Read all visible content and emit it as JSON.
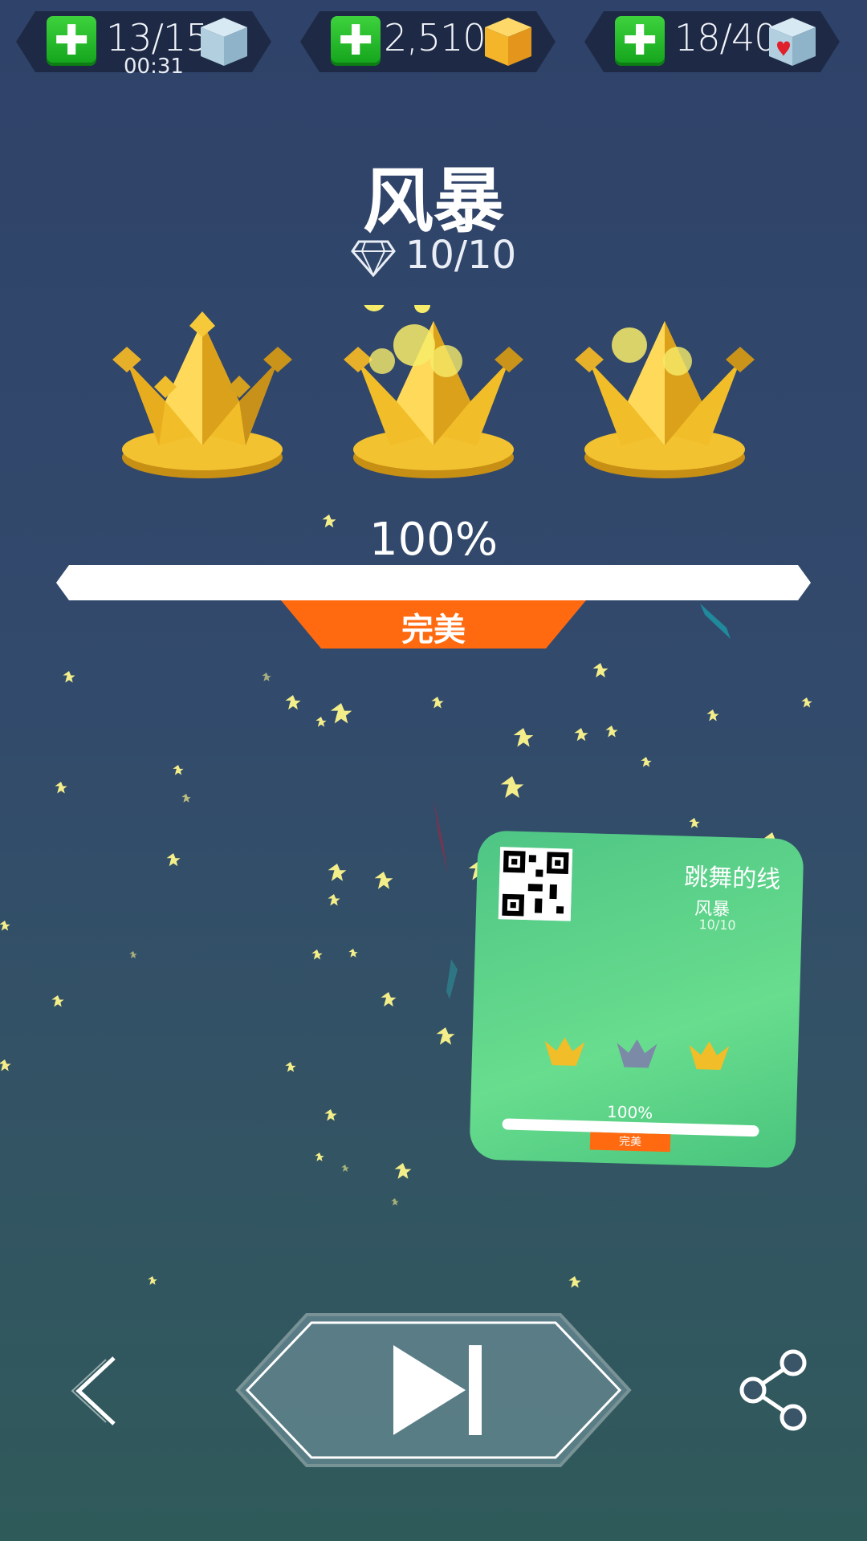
{
  "hud": {
    "energy": {
      "value": "13/15",
      "timer": "00:31",
      "icon": "ice-cube-icon"
    },
    "coins": {
      "value": "2,510",
      "icon": "gold-cube-icon"
    },
    "hearts": {
      "value": "18/40",
      "icon": "heart-cube-icon"
    }
  },
  "level": {
    "title": "风暴",
    "gems": "10/10",
    "crowns_earned": 3,
    "crowns_total": 3,
    "progress_label": "100%",
    "progress": 1.0,
    "rating": "完美"
  },
  "share_card": {
    "app_name": "跳舞的线",
    "level_title": "风暴",
    "gems": "10/10",
    "progress_label": "100%",
    "rating": "完美"
  },
  "colors": {
    "accent_orange": "#ff6a10",
    "plus_green": "#2bc12d",
    "gold": "#f4c22b"
  },
  "controls": {
    "back_icon": "chevron-left-icon",
    "next_icon": "skip-next-icon",
    "share_icon": "share-icon"
  }
}
